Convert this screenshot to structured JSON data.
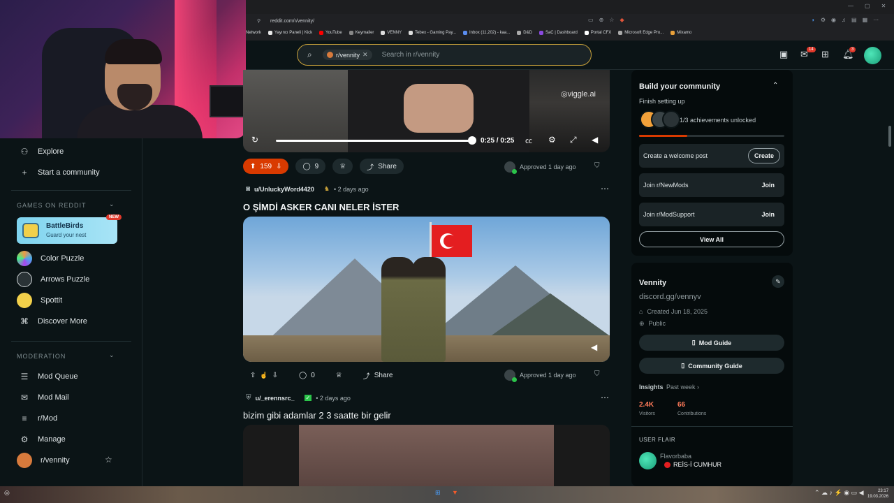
{
  "browser": {
    "url": "reddit.com/r/vennity/",
    "bookmarks": [
      "Network",
      "Yayıncı Paneli | Kick",
      "YouTube",
      "Keymailer",
      "VENNY",
      "Tebex - Gaming Pay...",
      "Inbox (11,202) - kaa...",
      "D&D",
      "SaC | Dashboard",
      "Portal CFX",
      "Microsoft Edge Pro...",
      "Mixamo"
    ]
  },
  "header": {
    "chip_label": "r/vennity",
    "search_placeholder": "Search in r/vennity",
    "chat_badge": "14",
    "notif_badge": "3"
  },
  "sidebar": {
    "explore": "Explore",
    "start_community": "Start a community",
    "games_heading": "GAMES ON REDDIT",
    "battlebirds_title": "BattleBirds",
    "battlebirds_sub": "Guard your nest",
    "new_badge": "NEW",
    "games": [
      "Color Puzzle",
      "Arrows Puzzle",
      "Spottit",
      "Discover More"
    ],
    "moderation_heading": "MODERATION",
    "mod_items": [
      "Mod Queue",
      "Mod Mail",
      "r/Mod",
      "Manage",
      "r/vennity"
    ]
  },
  "video_post": {
    "watermark": "viggle.ai",
    "time": "0:25 / 0:25",
    "progress": 1.0,
    "votes": "159",
    "comments": "9",
    "share": "Share",
    "approved": "Approved 1 day ago"
  },
  "post2": {
    "user": "u/UnluckyWord4420",
    "age": "• 2 days ago",
    "title": "O ŞİMDİ ASKER CANI NELER İSTER",
    "comments": "0",
    "share": "Share",
    "approved": "Approved 1 day ago"
  },
  "post3": {
    "user": "u/_erennsrc_",
    "age": "• 2 days ago",
    "title": "bizim gibi adamlar 2 3 saatte bir gelir"
  },
  "build": {
    "title": "Build your community",
    "finish": "Finish setting up",
    "achievements": "1/3 achievements unlocked",
    "progress": 0.33,
    "rows": [
      {
        "label": "Create a welcome post",
        "action": "Create"
      },
      {
        "label": "Join r/NewMods",
        "action": "Join"
      },
      {
        "label": "Join r/ModSupport",
        "action": "Join"
      }
    ],
    "view_all": "View All"
  },
  "about": {
    "name": "Vennity",
    "link": "discord.gg/vennyv",
    "created": "Created Jun 18, 2025",
    "visibility": "Public",
    "mod_guide": "Mod Guide",
    "community_guide": "Community Guide",
    "insights": "Insights",
    "insights_period": "Past week ›",
    "visitors_num": "2.4K",
    "visitors_lbl": "Visitors",
    "contrib_num": "66",
    "contrib_lbl": "Contributions",
    "user_flair_heading": "USER FLAIR",
    "flair_user": "Flavorbaba",
    "flair_text": "REİS-İ CUMHUR"
  },
  "clock": {
    "time": "23:17",
    "date": "19.03.2026"
  },
  "colors": {
    "upvote_active": "#d93a00",
    "accent_badge": "#e0382a",
    "search_border": "#c9a23a"
  }
}
